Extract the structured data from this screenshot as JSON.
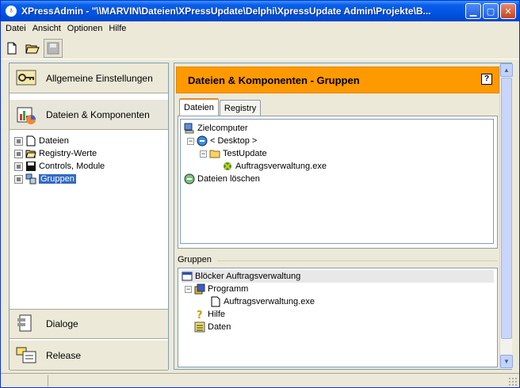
{
  "window": {
    "title": "XPressAdmin - \"\\\\MARVIN\\Dateien\\XPressUpdate\\Delphi\\XpressUpdate Admin\\Projekte\\B..."
  },
  "menu": [
    "Datei",
    "Ansicht",
    "Optionen",
    "Hilfe"
  ],
  "toolbar": {
    "new": "new-file",
    "open": "open-folder",
    "save": "save-disk"
  },
  "left": {
    "nav_general": "Allgemeine Einstellungen",
    "nav_files": "Dateien & Komponenten",
    "tree": [
      "Dateien",
      "Registry-Werte",
      "Controls, Module",
      "Gruppen"
    ],
    "nav_dialogs": "Dialoge",
    "nav_release": "Release"
  },
  "right": {
    "header": "Dateien & Komponenten - Gruppen",
    "help": "?",
    "tabs": [
      "Dateien",
      "Registry"
    ],
    "tree": {
      "target": "Zielcomputer",
      "desktop": "< Desktop >",
      "folder": "TestUpdate",
      "exe": "Auftragsverwaltung.exe",
      "delete": "Dateien löschen"
    },
    "groups_label": "Gruppen",
    "groups": {
      "blocker": "Blöcker Auftragsverwaltung",
      "program": "Programm",
      "program_exe": "Auftragsverwaltung.exe",
      "help": "Hilfe",
      "data": "Daten"
    }
  },
  "colors": {
    "accent": "#ff9900",
    "selection": "#316ac5",
    "title_bar": "#0054e3"
  }
}
